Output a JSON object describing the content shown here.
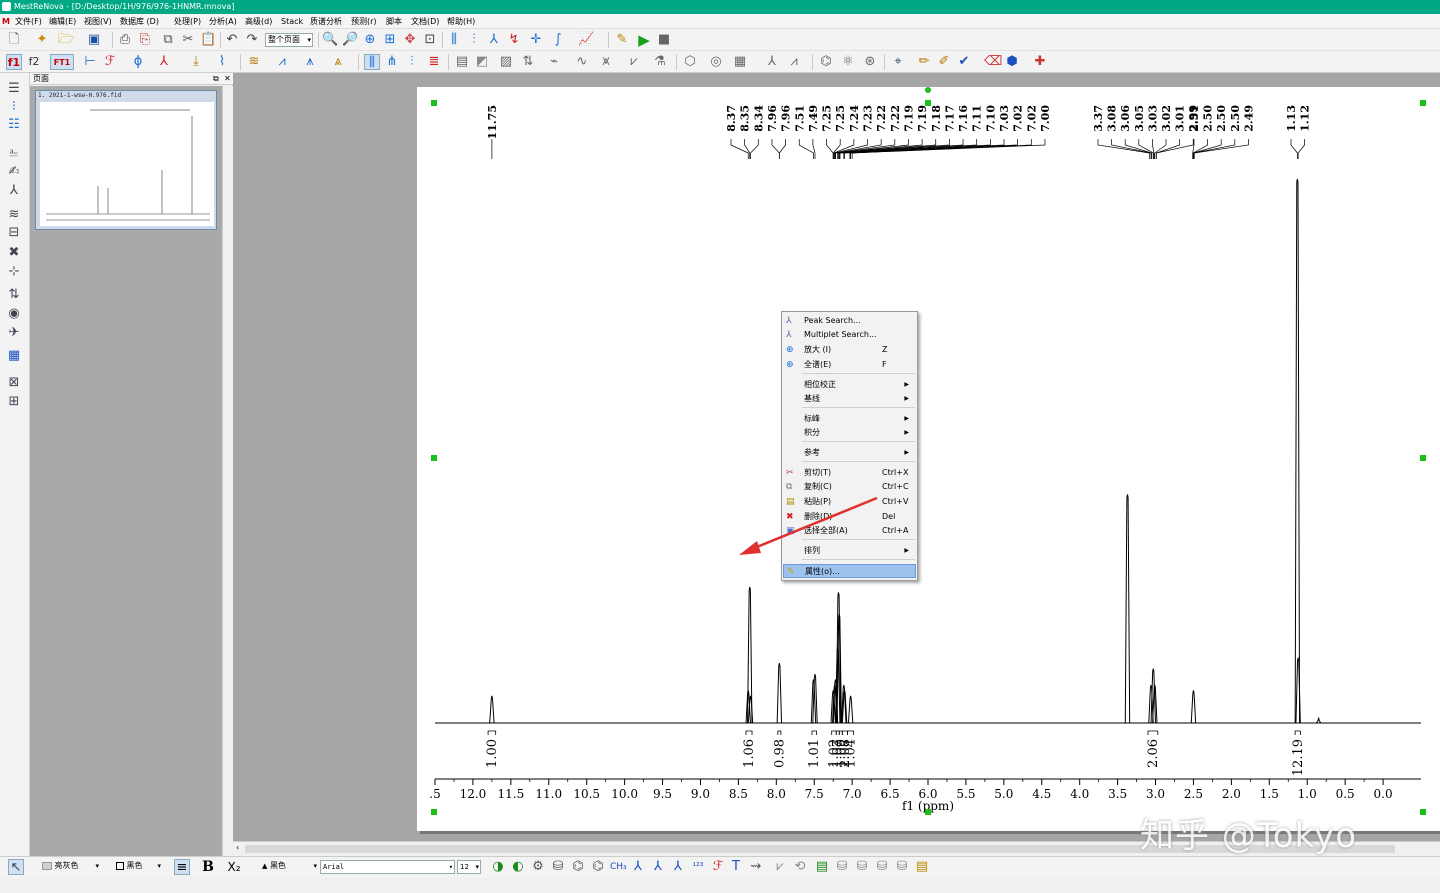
{
  "window": {
    "title": "MestReNova - [D:/Desktop/1H/976/976-1HNMR.mnova]"
  },
  "menu": [
    "文件(F)",
    "编辑(E)",
    "视图(V)",
    "数据库 (D)",
    "处理(P)",
    "分析(A)",
    "高级(d)",
    "Stack",
    "质谱分析",
    "预测(r)",
    "脚本",
    "文档(D)",
    "帮助(H)"
  ],
  "toolbar": {
    "page_view_combo": "整个页面",
    "f1_label": "f1",
    "f2_label": "f2",
    "ft1_label": "FT1"
  },
  "pages_panel": {
    "title": "页面",
    "thumbnail_label": "1. 2021-1-wsw-H.976.fid"
  },
  "spectrum": {
    "peak_labels_group1": [
      "11.75"
    ],
    "peak_labels_group2": [
      "8.37",
      "8.35",
      "8.34",
      "7.96",
      "7.96",
      "7.51",
      "7.49",
      "7.25",
      "7.25",
      "7.24",
      "7.23",
      "7.22",
      "7.22",
      "7.19",
      "7.19",
      "7.18",
      "7.17",
      "7.16",
      "7.11",
      "7.10",
      "7.03",
      "7.02",
      "7.02",
      "7.00"
    ],
    "peak_labels_group3": [
      "3.37",
      "3.08",
      "3.06",
      "3.05",
      "3.03",
      "3.02",
      "3.01",
      "2.99"
    ],
    "peak_labels_group4": [
      "2.51",
      "2.50",
      "2.50",
      "2.50",
      "2.49"
    ],
    "peak_labels_group5": [
      "1.13",
      "1.12"
    ],
    "integrals": [
      "1.00",
      "1.06",
      "0.98",
      "1.01",
      "1.02",
      "1.07",
      "1.09",
      "2.08",
      "1.04",
      "2.06",
      "12.19"
    ],
    "axis_ticks": [
      ".5",
      "12.0",
      "11.5",
      "11.0",
      "10.5",
      "10.0",
      "9.5",
      "9.0",
      "8.5",
      "8.0",
      "7.5",
      "7.0",
      "6.5",
      "6.0",
      "5.5",
      "5.0",
      "4.5",
      "4.0",
      "3.5",
      "3.0",
      "2.5",
      "2.0",
      "1.5",
      "1.0",
      "0.5",
      "0.0"
    ],
    "axis_title": "f1 (ppm)"
  },
  "chart_data": {
    "type": "line",
    "title": "",
    "xlabel": "f1 (ppm)",
    "ylabel": "",
    "xlim": [
      12.5,
      -0.5
    ],
    "reversed_x": true,
    "peaks": [
      {
        "ppm": 11.75,
        "height": 0.05
      },
      {
        "ppm": 8.37,
        "height": 0.06
      },
      {
        "ppm": 8.35,
        "height": 0.25
      },
      {
        "ppm": 8.34,
        "height": 0.05
      },
      {
        "ppm": 7.96,
        "height": 0.11
      },
      {
        "ppm": 7.51,
        "height": 0.08
      },
      {
        "ppm": 7.49,
        "height": 0.09
      },
      {
        "ppm": 7.25,
        "height": 0.06
      },
      {
        "ppm": 7.23,
        "height": 0.07
      },
      {
        "ppm": 7.22,
        "height": 0.08
      },
      {
        "ppm": 7.19,
        "height": 0.14
      },
      {
        "ppm": 7.18,
        "height": 0.24
      },
      {
        "ppm": 7.17,
        "height": 0.2
      },
      {
        "ppm": 7.11,
        "height": 0.07
      },
      {
        "ppm": 7.1,
        "height": 0.06
      },
      {
        "ppm": 7.02,
        "height": 0.05
      },
      {
        "ppm": 3.37,
        "height": 0.42
      },
      {
        "ppm": 3.06,
        "height": 0.07
      },
      {
        "ppm": 3.03,
        "height": 0.1
      },
      {
        "ppm": 3.01,
        "height": 0.07
      },
      {
        "ppm": 2.5,
        "height": 0.06
      },
      {
        "ppm": 1.13,
        "height": 1.0
      },
      {
        "ppm": 1.12,
        "height": 0.12
      },
      {
        "ppm": 0.85,
        "height": 0.01
      }
    ],
    "integrals": [
      {
        "from": 11.8,
        "to": 11.7,
        "value": "1.00"
      },
      {
        "from": 8.4,
        "to": 8.32,
        "value": "1.06"
      },
      {
        "from": 7.98,
        "to": 7.94,
        "value": "0.98"
      },
      {
        "from": 7.53,
        "to": 7.47,
        "value": "1.01"
      },
      {
        "from": 7.27,
        "to": 7.21,
        "value": "1.02"
      },
      {
        "from": 7.21,
        "to": 7.17,
        "value": "1.07"
      },
      {
        "from": 7.17,
        "to": 7.13,
        "value": "1.09"
      },
      {
        "from": 7.13,
        "to": 7.06,
        "value": "2.08"
      },
      {
        "from": 7.06,
        "to": 6.98,
        "value": "1.04"
      },
      {
        "from": 3.1,
        "to": 2.97,
        "value": "2.06"
      },
      {
        "from": 1.16,
        "to": 1.09,
        "value": "12.19"
      }
    ]
  },
  "context_menu": {
    "items": [
      {
        "label": "Peak Search...",
        "shortcut": "",
        "icon": "peak-search-icon",
        "submenu": false
      },
      {
        "label": "Multiplet Search...",
        "shortcut": "",
        "icon": "multiplet-search-icon",
        "submenu": false
      },
      {
        "label": "放大 (I)",
        "shortcut": "Z",
        "icon": "zoom-in-icon",
        "submenu": false
      },
      {
        "label": "全谱(E)",
        "shortcut": "F",
        "icon": "full-spectrum-icon",
        "submenu": false
      },
      {
        "label": "相位校正",
        "shortcut": "",
        "icon": "",
        "submenu": true
      },
      {
        "label": "基线",
        "shortcut": "",
        "icon": "",
        "submenu": true
      },
      {
        "label": "标峰",
        "shortcut": "",
        "icon": "",
        "submenu": true
      },
      {
        "label": "积分",
        "shortcut": "",
        "icon": "",
        "submenu": true
      },
      {
        "label": "参考",
        "shortcut": "",
        "icon": "",
        "submenu": true
      },
      {
        "label": "剪切(T)",
        "shortcut": "Ctrl+X",
        "icon": "cut-icon",
        "submenu": false
      },
      {
        "label": "复制(C)",
        "shortcut": "Ctrl+C",
        "icon": "copy-icon",
        "submenu": false
      },
      {
        "label": "粘贴(P)",
        "shortcut": "Ctrl+V",
        "icon": "paste-icon",
        "submenu": false
      },
      {
        "label": "删除(D)",
        "shortcut": "Del",
        "icon": "delete-icon",
        "submenu": false
      },
      {
        "label": "选择全部(A)",
        "shortcut": "Ctrl+A",
        "icon": "select-all-icon",
        "submenu": false
      },
      {
        "label": "排列",
        "shortcut": "",
        "icon": "",
        "submenu": true
      },
      {
        "label": "属性(o)...",
        "shortcut": "",
        "icon": "properties-icon",
        "submenu": false
      }
    ]
  },
  "bottom_toolbar": {
    "fill_color": "亮灰色",
    "line_color": "黑色",
    "font_color": "黑色",
    "font_name": "Arial",
    "font_size": "12"
  },
  "watermark": "知乎 @Tokyo",
  "colors": {
    "title_bar": "#00a885",
    "menu_highlight": "#9cc2ee",
    "handles": "#18c018",
    "arrow": "#e03030"
  }
}
